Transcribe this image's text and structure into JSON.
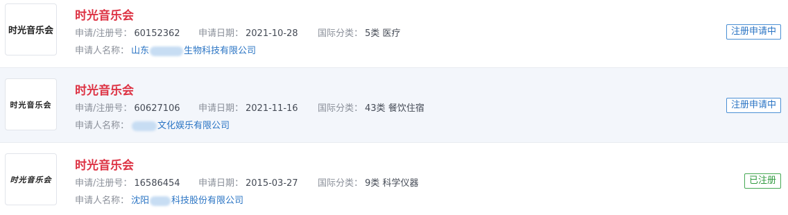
{
  "labels": {
    "reg_no": "申请/注册号：",
    "apply_date": "申请日期：",
    "intl_class": "国际分类：",
    "applicant": "申请人名称："
  },
  "colors": {
    "name_red": "#dd3344",
    "link_blue": "#2a74c4",
    "pending_blue": "#2a74c4",
    "registered_green": "#2f9a3e",
    "highlight_row_bg": "#f3f6fb"
  },
  "results": [
    {
      "logo_text": "时光音乐会",
      "name": "时光音乐会",
      "reg_no": "60152362",
      "apply_date": "2021-10-28",
      "intl_class": "5类 医疗",
      "applicant_prefix": "山东",
      "applicant_suffix": "生物科技有限公司",
      "status": "注册申请中",
      "status_type": "pending"
    },
    {
      "logo_text": "时光音乐会",
      "name": "时光音乐会",
      "reg_no": "60627106",
      "apply_date": "2021-11-16",
      "intl_class": "43类 餐饮住宿",
      "applicant_prefix": "",
      "applicant_suffix": "文化娱乐有限公司",
      "status": "注册申请中",
      "status_type": "pending"
    },
    {
      "logo_text": "时光音乐会",
      "name": "时光音乐会",
      "reg_no": "16586454",
      "apply_date": "2015-03-27",
      "intl_class": "9类 科学仪器",
      "applicant_prefix": "沈阳",
      "applicant_suffix": "科技股份有限公司",
      "status": "已注册",
      "status_type": "registered"
    }
  ]
}
